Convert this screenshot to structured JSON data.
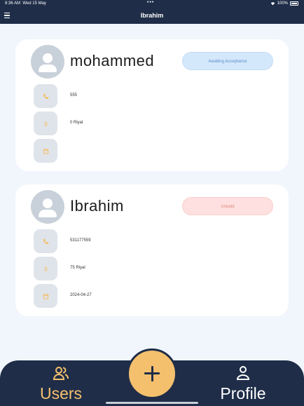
{
  "status_bar": {
    "time": "8:36 AM",
    "date": "Wed 15 May",
    "battery": "100%"
  },
  "nav": {
    "title": "Ibrahim",
    "menu_icon": "hamburger-icon"
  },
  "cards": [
    {
      "name": "mohammed",
      "status": "Awaiting Acceptance",
      "status_color": "#5a8dc8",
      "phone": "555",
      "amount": "0 Riyal",
      "date": ""
    },
    {
      "name": "Ibrahim",
      "status": "Unpaid",
      "status_color": "#e38a86",
      "phone": "531177559",
      "amount": "75 Riyal",
      "date": "2024-04-27"
    }
  ],
  "tabs": {
    "users_label": "Users",
    "profile_label": "Profile"
  },
  "colors": {
    "navy": "#1f2d48",
    "accent": "#f4c06d",
    "background": "#f1f5fc"
  }
}
